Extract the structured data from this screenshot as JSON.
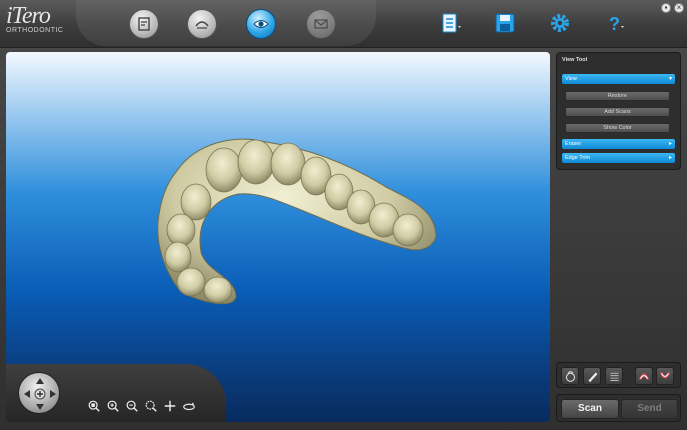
{
  "logo": {
    "name": "iTero",
    "sub": "ORTHODONTIC"
  },
  "toolbar": {
    "tools": [
      {
        "icon": "patient-info-icon",
        "state": "normal"
      },
      {
        "icon": "scan-mode-icon",
        "state": "normal"
      },
      {
        "icon": "eye-view-icon",
        "state": "active"
      },
      {
        "icon": "envelope-icon",
        "state": "disabled"
      }
    ],
    "menus": [
      "list-menu-icon",
      "save-disk-icon",
      "settings-gear-icon",
      "help-question-icon"
    ]
  },
  "view_tool": {
    "title": "View Tool",
    "view_section": "View",
    "buttons": [
      "Restore",
      "Add Scans",
      "Show Color"
    ],
    "eraser_section": "Eraser",
    "edge_trim_section": "Edge Trim"
  },
  "bottom": {
    "scan_label": "Scan",
    "send_label": "Send"
  },
  "colors": {
    "accent": "#1a9ae0",
    "model": "#d9d6b2"
  }
}
